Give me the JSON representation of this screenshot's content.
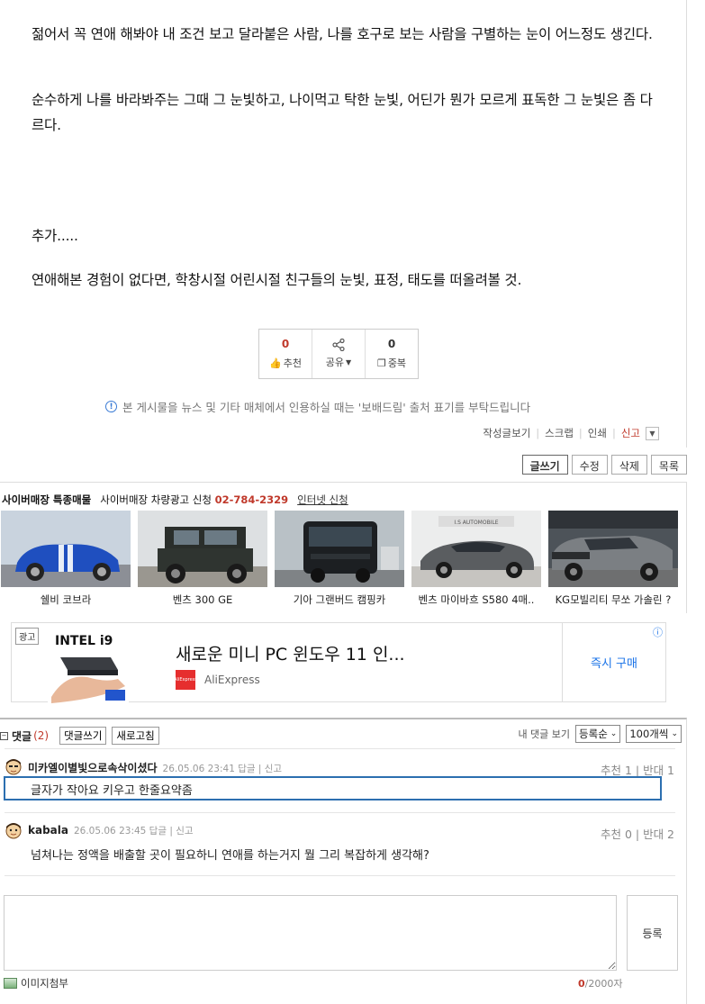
{
  "article": {
    "paragraphs": [
      "젊어서 꼭 연애 해봐야 내 조건 보고 달라붙은 사람, 나를 호구로 보는 사람을 구별하는 눈이 어느정도 생긴다.",
      "순수하게 나를 바라봐주는 그때 그 눈빛하고, 나이먹고 탁한 눈빛, 어딘가 뭔가 모르게 표독한 그 눈빛은 좀 다르다.",
      "추가.....",
      "연애해본 경험이 없다면, 학창시절 어린시절 친구들의 눈빛, 표정, 태도를 떠올려볼 것."
    ]
  },
  "votes": {
    "recommend_count": "0",
    "recommend_label": "추천",
    "share_label": "공유",
    "duplicate_count": "0",
    "duplicate_label": "중복"
  },
  "notice": "본 게시물을 뉴스 및 기타 매체에서 인용하실 때는 '보배드림' 출처 표기를 부탁드립니다",
  "meta_links": {
    "view_posts": "작성글보기",
    "scrap": "스크랩",
    "print": "인쇄",
    "report": "신고"
  },
  "actions": {
    "write": "글쓰기",
    "edit": "수정",
    "delete": "삭제",
    "list": "목록"
  },
  "cyber": {
    "title": "사이버매장 특종매물",
    "sub": "사이버매장 차량광고 신청",
    "phone": "02-784-2329",
    "link": "인터넷 신청",
    "cars": [
      {
        "name": "쉘비 코브라"
      },
      {
        "name": "벤츠 300 GE"
      },
      {
        "name": "기아 그랜버드 캠핑카"
      },
      {
        "name": "벤츠 마이바흐 S580 4매.."
      },
      {
        "name": "KG모빌리티 무쏘 가솔린 ?"
      }
    ]
  },
  "ad": {
    "badge": "광고",
    "product_text": "INTEL i9",
    "title": "새로운 미니 PC 윈도우 11 인...",
    "brand": "AliExpress",
    "logo_text": "AliExpress",
    "cta": "즉시 구매",
    "info": "ⓘ"
  },
  "comments": {
    "title": "댓글",
    "count": "(2)",
    "write_btn": "댓글쓰기",
    "refresh_btn": "새로고침",
    "my_comments": "내 댓글 보기",
    "sort": "등록순",
    "per_page": "100개씩",
    "items": [
      {
        "user": "미카엘이별빛으로속삭이셨다",
        "meta": "26.05.06 23:41 답글 | 신고",
        "votes": "추천 1 | 반대 1",
        "text": "글자가 작아요 키우고 한줄요약좀"
      },
      {
        "user": "kabala",
        "meta": "26.05.06 23:45 답글 | 신고",
        "votes": "추천 0 | 반대 2",
        "text": "넘쳐나는 정액을 배출할 곳이 필요하니 연애를 하는거지 뭘 그리 복잡하게 생각해?"
      }
    ],
    "submit": "등록",
    "attach": "이미지첨부",
    "counter_now": "0",
    "counter_max": "/2000자"
  }
}
